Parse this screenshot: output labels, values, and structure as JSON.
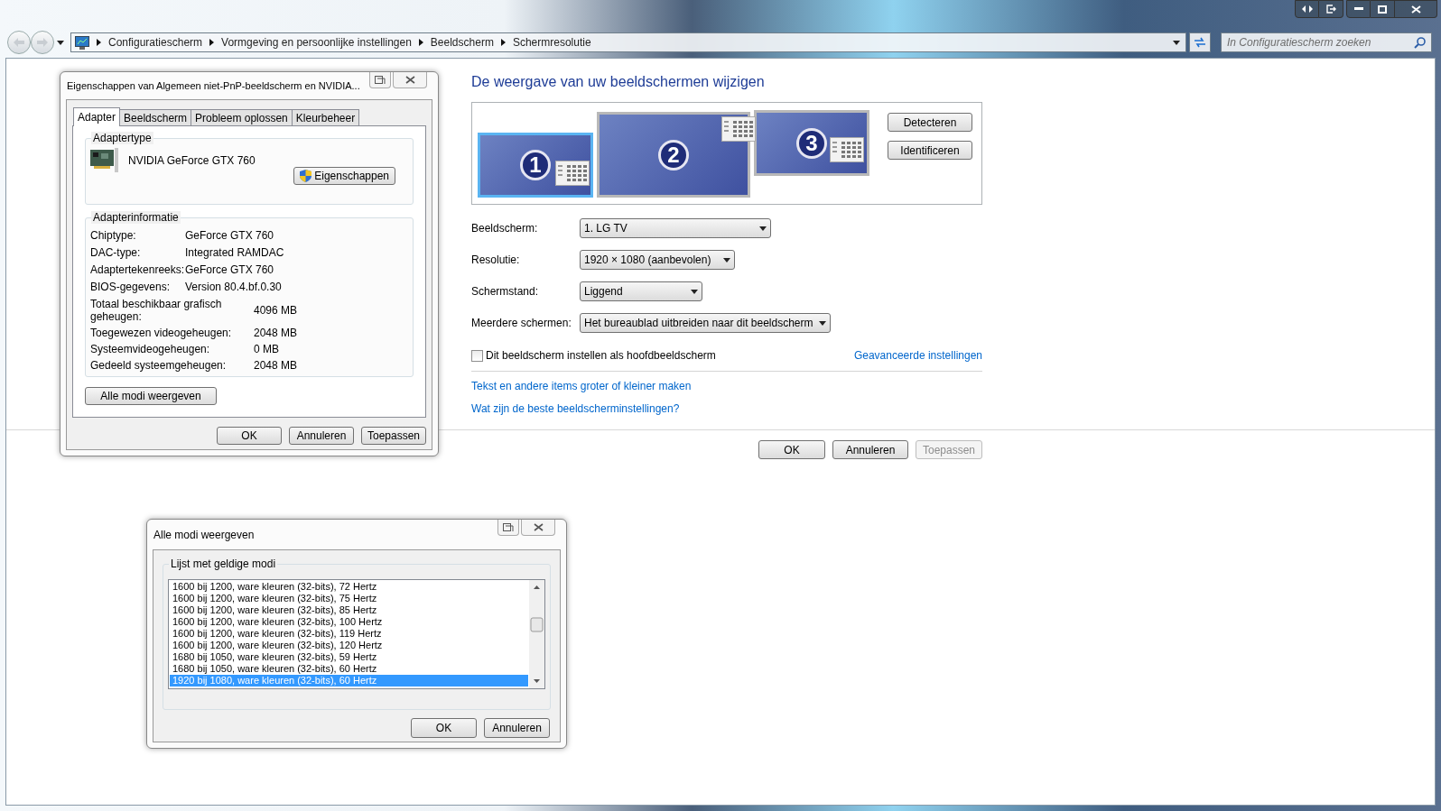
{
  "address_bar": {
    "crumbs": [
      "Configuratiescherm",
      "Vormgeving en persoonlijke instellingen",
      "Beeldscherm",
      "Schermresolutie"
    ]
  },
  "search": {
    "placeholder": "In Configuratiescherm zoeken"
  },
  "main": {
    "heading": "De weergave van uw beeldschermen wijzigen",
    "monitors": [
      {
        "number": "1",
        "selected": true
      },
      {
        "number": "2",
        "selected": false
      },
      {
        "number": "3",
        "selected": false
      }
    ],
    "monitor_buttons": [
      "Detecteren",
      "Identificeren"
    ],
    "fields": [
      {
        "label": "Beeldscherm:",
        "value": "1. LG TV"
      },
      {
        "label": "Resolutie:",
        "value": "1920 × 1080 (aanbevolen)"
      },
      {
        "label": "Schermstand:",
        "value": "Liggend"
      },
      {
        "label": "Meerdere schermen:",
        "value": "Het bureaublad uitbreiden naar dit beeldscherm"
      }
    ],
    "checkbox": {
      "label": "Dit beeldscherm instellen als hoofdbeeldscherm",
      "checked": false
    },
    "advanced_link": "Geavanceerde instellingen",
    "links": [
      "Tekst en andere items groter of kleiner maken",
      "Wat zijn de beste beeldscherminstellingen?"
    ],
    "buttons": [
      {
        "label": "OK",
        "disabled": false
      },
      {
        "label": "Annuleren",
        "disabled": false
      },
      {
        "label": "Toepassen",
        "disabled": true
      }
    ]
  },
  "properties_dialog": {
    "title": "Eigenschappen van Algemeen niet-PnP-beeldscherm en NVIDIA...",
    "tabs": [
      {
        "label": "Adapter",
        "selected": true
      },
      {
        "label": "Beeldscherm",
        "selected": false
      },
      {
        "label": "Probleem oplossen",
        "selected": false
      },
      {
        "label": "Kleurbeheer",
        "selected": false
      }
    ],
    "adapter_type": {
      "legend": "Adaptertype",
      "name": "NVIDIA GeForce GTX 760",
      "button": "Eigenschappen"
    },
    "adapter_info": {
      "legend": "Adapterinformatie",
      "rows": [
        {
          "label": "Chiptype:",
          "value": "GeForce GTX 760"
        },
        {
          "label": "DAC-type:",
          "value": "Integrated RAMDAC"
        },
        {
          "label": "Adaptertekenreeks:",
          "value": "GeForce GTX 760"
        },
        {
          "label": "BIOS-gegevens:",
          "value": "Version 80.4.bf.0.30"
        }
      ],
      "memory_rows": [
        {
          "label": "Totaal beschikbaar grafisch geheugen:",
          "value": "4096 MB"
        },
        {
          "label": "Toegewezen videogeheugen:",
          "value": "2048 MB"
        },
        {
          "label": "Systeemvideogeheugen:",
          "value": "0 MB"
        },
        {
          "label": "Gedeeld systeemgeheugen:",
          "value": "2048 MB"
        }
      ]
    },
    "modes_button": "Alle modi weergeven",
    "buttons": [
      "OK",
      "Annuleren",
      "Toepassen"
    ]
  },
  "modes_dialog": {
    "title": "Alle modi weergeven",
    "legend": "Lijst met geldige modi",
    "items": [
      {
        "label": "1600 bij 1200, ware kleuren (32-bits), 72 Hertz",
        "selected": false
      },
      {
        "label": "1600 bij 1200, ware kleuren (32-bits), 75 Hertz",
        "selected": false
      },
      {
        "label": "1600 bij 1200, ware kleuren (32-bits), 85 Hertz",
        "selected": false
      },
      {
        "label": "1600 bij 1200, ware kleuren (32-bits), 100 Hertz",
        "selected": false
      },
      {
        "label": "1600 bij 1200, ware kleuren (32-bits), 119 Hertz",
        "selected": false
      },
      {
        "label": "1600 bij 1200, ware kleuren (32-bits), 120 Hertz",
        "selected": false
      },
      {
        "label": "1680 bij 1050, ware kleuren (32-bits), 59 Hertz",
        "selected": false
      },
      {
        "label": "1680 bij 1050, ware kleuren (32-bits), 60 Hertz",
        "selected": false
      },
      {
        "label": "1920 bij 1080, ware kleuren (32-bits), 60 Hertz",
        "selected": true
      }
    ],
    "buttons": [
      "OK",
      "Annuleren"
    ]
  }
}
